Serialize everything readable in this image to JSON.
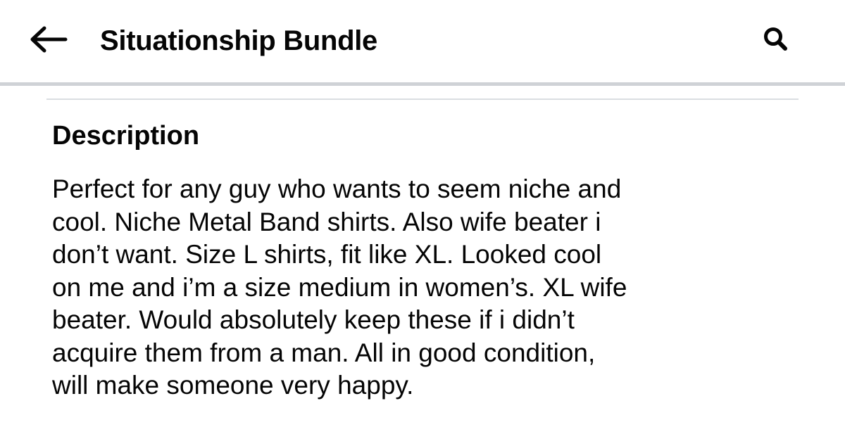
{
  "header": {
    "title": "Situationship Bundle",
    "back_icon": "arrow-left-icon",
    "search_icon": "search-icon"
  },
  "listing": {
    "section_title": "Description",
    "description_lines": [
      "Perfect for any guy who wants to seem niche and",
      "cool. Niche Metal Band shirts. Also wife beater i",
      "don’t want. Size L shirts, fit like XL. Looked cool",
      "on me and i’m a size medium in women’s. XL wife",
      "beater. Would absolutely keep these if i didn’t",
      "acquire them from a man. All in good condition,",
      "will make someone very happy."
    ]
  },
  "colors": {
    "text": "#050505",
    "background": "#ffffff",
    "divider": "#cfd2d6"
  }
}
